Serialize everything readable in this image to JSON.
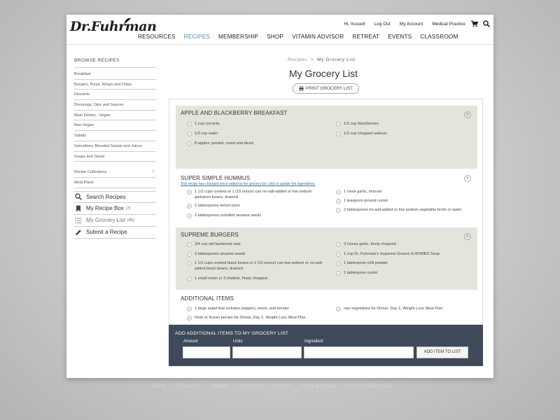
{
  "header": {
    "logo": "Dr.Fuhrman",
    "top_links": [
      "Hi, Irussell",
      "Log Out",
      "My Account",
      "Medical Practice"
    ],
    "nav": [
      "RESOURCES",
      "RECIPES",
      "MEMBERSHIP",
      "SHOP",
      "VITAMIN ADVISOR",
      "RETREAT",
      "EVENTS",
      "CLASSROOM"
    ],
    "active_nav": "RECIPES",
    "accent_color": "#4a90a8"
  },
  "sidebar": {
    "heading": "BROWSE RECIPES",
    "categories": [
      "Breakfast",
      "Burgers, Pizza, Wraps and Chips",
      "Desserts",
      "Dressings, Dips and Sauces",
      "Main Dishes - Vegan",
      "Non-Vegan",
      "Salads",
      "Smoothies, Blended Salads and Juices",
      "Soups and Stews"
    ],
    "collections": "Recipe Collections",
    "meal_plans": "Meal Plans",
    "actions": [
      {
        "label": "Search Recipes",
        "icon": "search-icon",
        "count": ""
      },
      {
        "label": "My Recipe Box",
        "icon": "bookmark-icon",
        "count": "(7)"
      },
      {
        "label": "My Grocery List",
        "icon": "list-icon",
        "count": "(45)"
      },
      {
        "label": "Submit a Recipe",
        "icon": "pencil-icon",
        "count": ""
      }
    ]
  },
  "main": {
    "breadcrumb": [
      "Recipes",
      ">",
      "My Grocery List"
    ],
    "title": "My Grocery List",
    "print_label": "PRINT GROCERY LIST"
  },
  "recipes": [
    {
      "title": "APPLE AND BLACKBERRY BREAKFAST",
      "note": "",
      "left": [
        "1 cup currants",
        "1/3 cup water",
        "8  apples, peeled, cored and diced"
      ],
      "right": [
        "1/2 cup blackberries",
        "1/2 cup chopped walnuts"
      ]
    },
    {
      "title": "SUPER SIMPLE HUMMUS",
      "note": "This recipe has changed since added to the grocery list: click to update the ingredients.",
      "left": [
        "1 1/2 cups cooked or 1 (15 ounce) can no-salt-added or low sodium garbanzo beans, drained",
        "2 tablespoons lemon juice",
        "2 tablespoons unhulled sesame seeds"
      ],
      "right": [
        "1 clove garlic, minced",
        "1 teaspoon ground cumin",
        "2 tablespoons no-salt-added or low sodium vegetable broth or water"
      ]
    },
    {
      "title": "SUPREME BURGERS",
      "note": "",
      "left": [
        "3/4 cup old-fashioned oats",
        "2 tablespoons sesame seeds",
        "1 1/2 cups cooked black beans or 1 (15 ounce) can low sodium or no-salt-added black beans, drained",
        "1 small onion or 3 shallots, finely chopped"
      ],
      "right": [
        "3 cloves garlic, finely chopped",
        "1 cup Dr. Fuhrman's Supreme Greens G-BOMBS Soup",
        "1 tablespoon chili powder",
        "1 tablespoon cumin"
      ]
    },
    {
      "title": "ADDITIONAL ITEMS",
      "note": "",
      "left": [
        "1 large salad that includes peppers, onion, and tomato",
        "fresh or frozen berries for Dinner, Day 1, Weight Loss Meal Plan"
      ],
      "right": [
        "raw vegetables for Dinner, Day 1, Weight Loss Meal Plan"
      ]
    }
  ],
  "add_items": {
    "title": "ADD ADDITIONAL ITEMS TO MY GROCERY LIST",
    "labels": [
      "Amount",
      "Units",
      "Ingredient"
    ],
    "button": "ADD ITEM TO LIST"
  },
  "footer": [
    "About",
    "Contact Us",
    "Affiliate",
    "Wholesale",
    "Careers",
    "Press & Media",
    "Join Our Mailing List"
  ]
}
